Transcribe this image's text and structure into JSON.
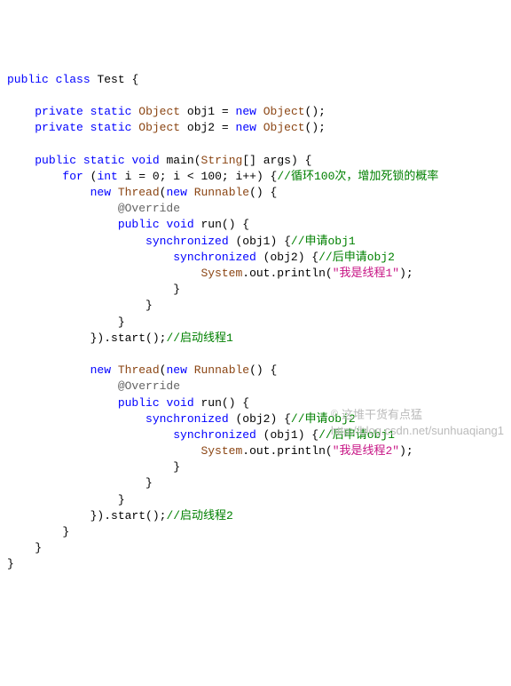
{
  "kw": {
    "public": "public",
    "class": "class",
    "private": "private",
    "static": "static",
    "new": "new",
    "void": "void",
    "for": "for",
    "int": "int",
    "synchronized": "synchronized"
  },
  "type": {
    "Object": "Object",
    "String": "String",
    "Thread": "Thread",
    "Runnable": "Runnable",
    "System": "System"
  },
  "id": {
    "Test": "Test",
    "obj1": "obj1",
    "obj2": "obj2",
    "main": "main",
    "args": "args",
    "i": "i",
    "run": "run",
    "out": "out",
    "println": "println",
    "start": "start"
  },
  "ann": {
    "Override": "@Override"
  },
  "num": {
    "zero": "0",
    "hundred": "100"
  },
  "cmt": {
    "loop": "//循环100次，增加死锁的概率",
    "apply_obj1": "//申请obj1",
    "then_apply_obj2": "//后申请obj2",
    "start_thread1": "//启动线程1",
    "apply_obj2": "//申请obj2",
    "then_apply_obj1": "//后申请obj1",
    "start_thread2": "//启动线程2"
  },
  "str": {
    "thread1": "\"我是线程1\"",
    "thread2": "\"我是线程2\""
  },
  "watermark": {
    "badge": "©",
    "tag": "这堆干货有点猛",
    "url": "http://blog.csdn.net/sunhuaqiang1"
  }
}
